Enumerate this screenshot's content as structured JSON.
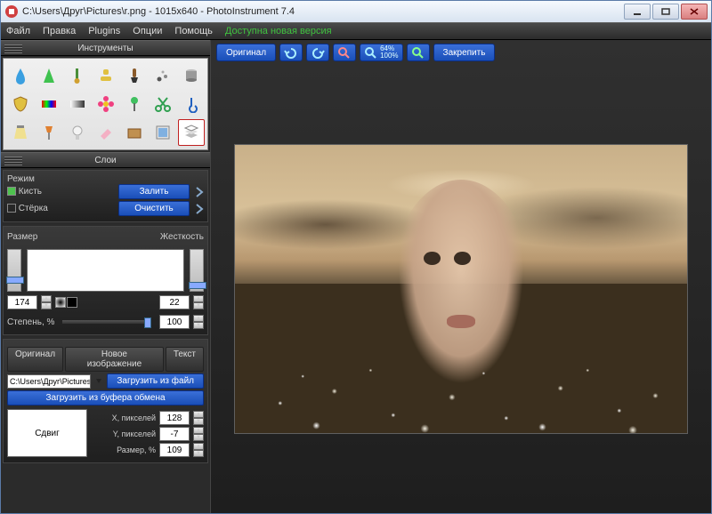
{
  "window": {
    "title": "C:\\Users\\Друг\\Pictures\\r.png - 1015x640 - PhotoInstrument 7.4"
  },
  "menu": {
    "items": [
      "Файл",
      "Правка",
      "Plugins",
      "Опции",
      "Помощь"
    ],
    "update": "Доступна новая версия"
  },
  "toolbar": {
    "original": "Оригинал",
    "zoom_top": "64%",
    "zoom_bottom": "100%",
    "pin": "Закрепить"
  },
  "panels": {
    "tools_title": "Инструменты",
    "layers_title": "Слои"
  },
  "tool_names": [
    "droplet",
    "cone",
    "heal-brush",
    "stamp",
    "brush",
    "blur",
    "metal",
    "palette",
    "hue",
    "gradient",
    "flower",
    "pin",
    "scissors",
    "hook",
    "light-top",
    "lamp",
    "bulb",
    "eraser2",
    "wood",
    "layers",
    "pages"
  ],
  "mode": {
    "label": "Режим",
    "brush": "Кисть",
    "eraser": "Стёрка",
    "fill": "Залить",
    "clear": "Очистить"
  },
  "size": {
    "label": "Размер",
    "hardness_label": "Жесткость",
    "value": "174",
    "hardness": "22"
  },
  "opacity": {
    "label": "Степень, %",
    "value": "100"
  },
  "tabs": {
    "original": "Оригинал",
    "new_image": "Новое изображение",
    "text": "Текст"
  },
  "file": {
    "path": "C:\\Users\\Друг\\Pictures\\foto na",
    "load_from_file": "Загрузить из файл",
    "load_from_clipboard": "Загрузить из буфера обмена"
  },
  "offset": {
    "shift": "Сдвиг",
    "x_label": "X, пикселей",
    "y_label": "Y, пикселей",
    "size_label": "Размер, %",
    "x": "128",
    "y": "-7",
    "size": "109"
  }
}
